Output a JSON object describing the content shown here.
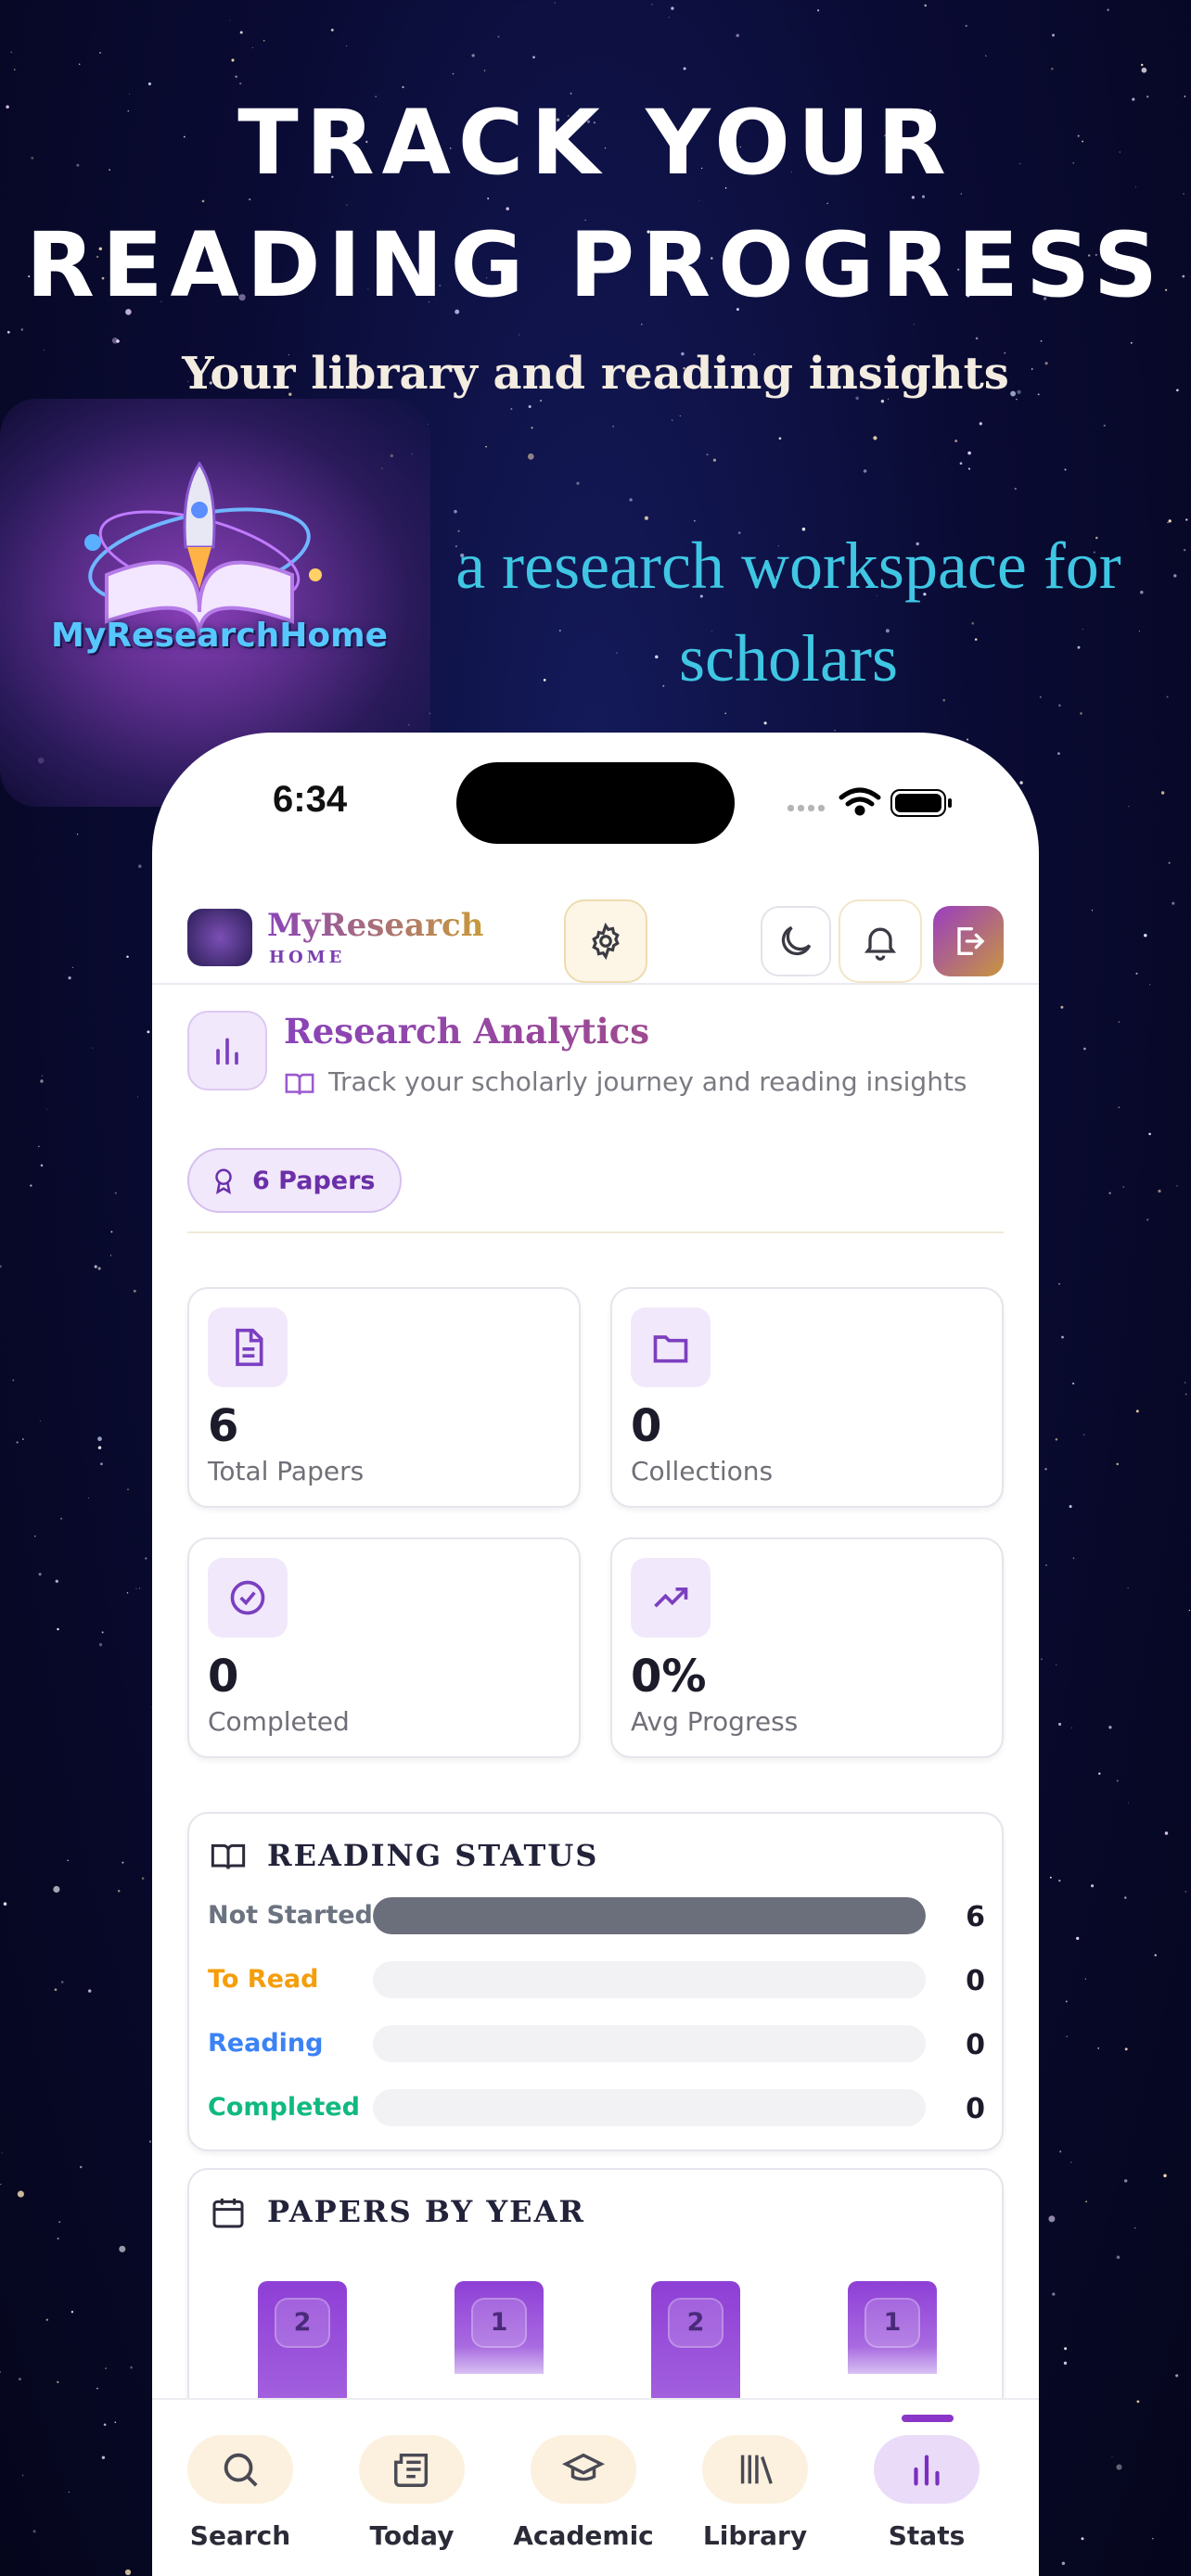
{
  "hero": {
    "title": "Track your reading progress",
    "subtitle": "Your library and reading insights",
    "tagline": "a research workspace for scholars"
  },
  "logo": {
    "name": "MyResearchHome"
  },
  "status_bar": {
    "time": "6:34"
  },
  "header": {
    "brand_name": "MyResearch",
    "brand_sub": "HOME"
  },
  "page": {
    "title": "Research Analytics",
    "subtitle": "Track your scholarly journey and reading insights",
    "papers_badge": "6 Papers"
  },
  "stats": [
    {
      "value": "6",
      "label": "Total Papers",
      "icon": "document-icon"
    },
    {
      "value": "0",
      "label": "Collections",
      "icon": "folder-icon"
    },
    {
      "value": "0",
      "label": "Completed",
      "icon": "check-circle-icon"
    },
    {
      "value": "0%",
      "label": "Avg Progress",
      "icon": "trending-up-icon"
    }
  ],
  "reading_status": {
    "title": "READING STATUS",
    "rows": [
      {
        "label": "Not Started",
        "count": "6",
        "fraction": 1.0,
        "color": "#6b7280"
      },
      {
        "label": "To Read",
        "count": "0",
        "fraction": 0,
        "color": "#f59e0b"
      },
      {
        "label": "Reading",
        "count": "0",
        "fraction": 0,
        "color": "#3b82f6"
      },
      {
        "label": "Completed",
        "count": "0",
        "fraction": 0,
        "color": "#10b981"
      }
    ]
  },
  "papers_by_year": {
    "title": "PAPERS BY YEAR",
    "counts": [
      "2",
      "1",
      "2",
      "1"
    ]
  },
  "tabs": [
    {
      "label": "Search",
      "icon": "search-icon"
    },
    {
      "label": "Today",
      "icon": "newspaper-icon"
    },
    {
      "label": "Academic",
      "icon": "graduation-cap-icon"
    },
    {
      "label": "Library",
      "icon": "library-icon"
    },
    {
      "label": "Stats",
      "icon": "bar-chart-icon",
      "active": true
    }
  ],
  "colors": {
    "accent": "#8a36c8",
    "gold": "#c89a3a",
    "tagline": "#3fc6e3"
  }
}
